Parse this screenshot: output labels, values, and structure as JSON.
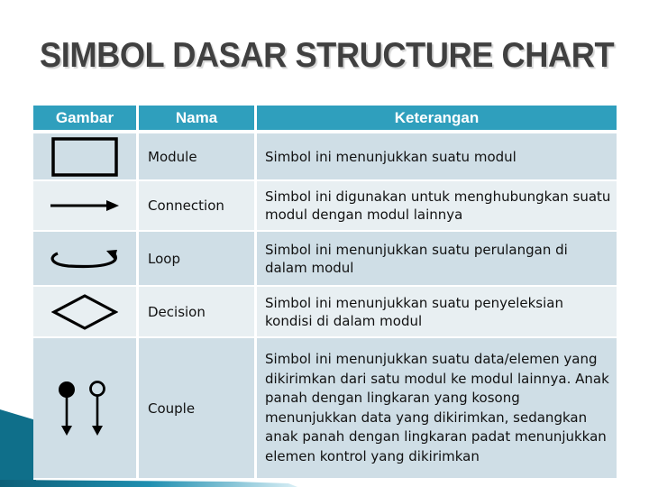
{
  "title": "SIMBOL DASAR STRUCTURE CHART",
  "table": {
    "headers": {
      "gambar": "Gambar",
      "nama": "Nama",
      "keterangan": "Keterangan"
    },
    "rows": [
      {
        "icon": "module-rectangle-icon",
        "name": "Module",
        "description": "Simbol ini menunjukkan suatu modul"
      },
      {
        "icon": "connection-arrow-icon",
        "name": "Connection",
        "description": "Simbol ini digunakan untuk menghubungkan suatu modul dengan modul lainnya"
      },
      {
        "icon": "loop-arrow-icon",
        "name": "Loop",
        "description": "Simbol ini menunjukkan suatu perulangan di dalam modul"
      },
      {
        "icon": "decision-diamond-icon",
        "name": "Decision",
        "description": "Simbol ini menunjukkan suatu penyeleksian kondisi di dalam modul"
      },
      {
        "icon": "couple-arrows-icon",
        "name": "Couple",
        "description": "Simbol ini menunjukkan suatu data/elemen yang dikirimkan dari satu modul ke modul lainnya. Anak panah dengan lingkaran yang kosong menunjukkan data yang dikirimkan, sedangkan anak panah dengan lingkaran padat menunjukkan elemen kontrol yang dikirimkan"
      }
    ]
  },
  "colors": {
    "header_bg": "#2f9fbd",
    "row_dark": "#cfdee6",
    "row_light": "#e8eff2",
    "title_text": "#404040",
    "decoration": "#0f6f8a"
  }
}
